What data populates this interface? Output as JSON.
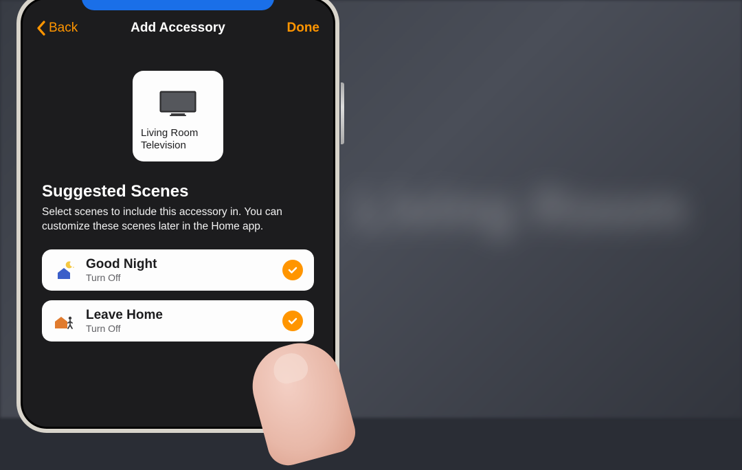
{
  "nav": {
    "back": "Back",
    "title": "Add Accessory",
    "done": "Done"
  },
  "accessory": {
    "name": "Living Room Television"
  },
  "section": {
    "title": "Suggested Scenes",
    "subtitle": "Select scenes to include this accessory in. You can customize these scenes later in the Home app."
  },
  "scenes": [
    {
      "icon": "good-night-icon",
      "title": "Good Night",
      "subtitle": "Turn Off",
      "selected": true
    },
    {
      "icon": "leave-home-icon",
      "title": "Leave Home",
      "subtitle": "Turn Off",
      "selected": true
    }
  ],
  "colors": {
    "accent": "#ff9500",
    "scene_house_night": "#3b5fc9",
    "scene_house_leave": "#e07b2e"
  }
}
